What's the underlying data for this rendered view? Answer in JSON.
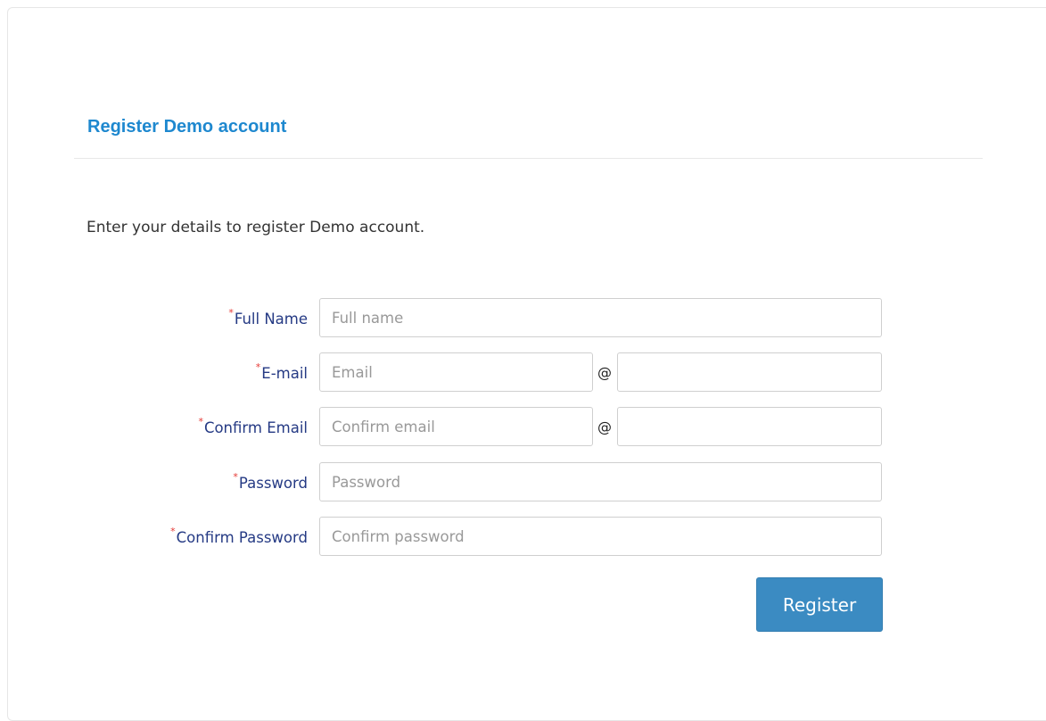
{
  "panel": {
    "title": "Register Demo account",
    "intro": "Enter your details to register Demo account."
  },
  "form": {
    "required_marker": "*",
    "full_name": {
      "label": "Full Name",
      "placeholder": "Full name",
      "value": ""
    },
    "email": {
      "label": "E-mail",
      "placeholder": "Email",
      "value": "",
      "at_symbol": "@",
      "domain_value": ""
    },
    "confirm_email": {
      "label": "Confirm Email",
      "placeholder": "Confirm email",
      "value": "",
      "at_symbol": "@",
      "domain_value": ""
    },
    "password": {
      "label": "Password",
      "placeholder": "Password",
      "value": ""
    },
    "confirm_password": {
      "label": "Confirm Password",
      "placeholder": "Confirm password",
      "value": ""
    },
    "submit_label": "Register"
  },
  "colors": {
    "title": "#1e88cf",
    "label": "#253a84",
    "required": "#e53935",
    "button": "#3b8bc2"
  }
}
